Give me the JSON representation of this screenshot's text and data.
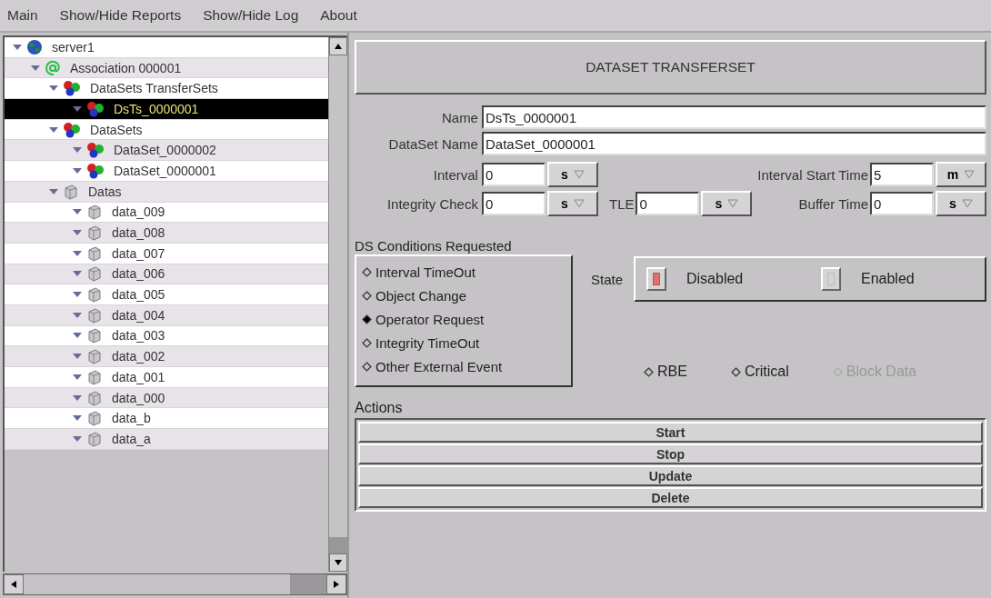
{
  "menu": [
    "Main",
    "Show/Hide Reports",
    "Show/Hide Log",
    "About"
  ],
  "tree": [
    {
      "label": "server1",
      "kind": "globe",
      "expanded": true,
      "selected": false,
      "children": [
        {
          "label": "Association 000001",
          "kind": "association",
          "expanded": true,
          "selected": false,
          "children": [
            {
              "label": "DataSets TransferSets",
              "kind": "dataset",
              "expanded": true,
              "selected": false,
              "children": [
                {
                  "label": "DsTs_0000001",
                  "kind": "dataset",
                  "expanded": true,
                  "selected": true
                }
              ]
            },
            {
              "label": "DataSets",
              "kind": "dataset",
              "expanded": true,
              "selected": false,
              "children": [
                {
                  "label": "DataSet_0000002",
                  "kind": "dataset",
                  "expanded": true,
                  "selected": false
                },
                {
                  "label": "DataSet_0000001",
                  "kind": "dataset",
                  "expanded": true,
                  "selected": false
                }
              ]
            },
            {
              "label": "Datas",
              "kind": "data",
              "expanded": true,
              "selected": false,
              "children": [
                {
                  "label": "data_009",
                  "kind": "data",
                  "expanded": true,
                  "selected": false
                },
                {
                  "label": "data_008",
                  "kind": "data",
                  "expanded": true,
                  "selected": false
                },
                {
                  "label": "data_007",
                  "kind": "data",
                  "expanded": true,
                  "selected": false
                },
                {
                  "label": "data_006",
                  "kind": "data",
                  "expanded": true,
                  "selected": false
                },
                {
                  "label": "data_005",
                  "kind": "data",
                  "expanded": true,
                  "selected": false
                },
                {
                  "label": "data_004",
                  "kind": "data",
                  "expanded": true,
                  "selected": false
                },
                {
                  "label": "data_003",
                  "kind": "data",
                  "expanded": true,
                  "selected": false
                },
                {
                  "label": "data_002",
                  "kind": "data",
                  "expanded": true,
                  "selected": false
                },
                {
                  "label": "data_001",
                  "kind": "data",
                  "expanded": true,
                  "selected": false
                },
                {
                  "label": "data_000",
                  "kind": "data",
                  "expanded": true,
                  "selected": false
                },
                {
                  "label": "data_b",
                  "kind": "data",
                  "expanded": true,
                  "selected": false
                },
                {
                  "label": "data_a",
                  "kind": "data",
                  "expanded": true,
                  "selected": false
                }
              ]
            }
          ]
        }
      ]
    }
  ],
  "header": "DATASET TRANSFERSET",
  "name": {
    "label": "Name",
    "value": "DsTs_0000001"
  },
  "dataset_name": {
    "label": "DataSet Name",
    "value": "DataSet_0000001"
  },
  "times": [
    [
      {
        "label": "Interval",
        "value": "0",
        "unit": "s"
      },
      {
        "label": "Interval Start Time",
        "value": "5",
        "unit": "m"
      }
    ],
    [
      {
        "label": "Integrity Check",
        "value": "0",
        "unit": "s"
      },
      {
        "label": "TLE",
        "value": "0",
        "unit": "s"
      },
      {
        "label": "Buffer Time",
        "value": "0",
        "unit": "s"
      }
    ]
  ],
  "conditions": {
    "title": "DS Conditions Requested",
    "items": [
      {
        "label": "Interval TimeOut",
        "checked": false
      },
      {
        "label": "Object Change",
        "checked": false
      },
      {
        "label": "Operator Request",
        "checked": true
      },
      {
        "label": "Integrity TimeOut",
        "checked": false
      },
      {
        "label": "Other External Event",
        "checked": false
      }
    ]
  },
  "state": {
    "label": "State",
    "options": [
      {
        "label": "Disabled",
        "selected": true
      },
      {
        "label": "Enabled",
        "selected": false
      }
    ]
  },
  "flags": [
    {
      "label": "RBE",
      "checked": false,
      "disabled": false
    },
    {
      "label": "Critical",
      "checked": false,
      "disabled": false
    },
    {
      "label": "Block Data",
      "checked": false,
      "disabled": true
    }
  ],
  "actions": {
    "title": "Actions",
    "buttons": [
      "Start",
      "Stop",
      "Update",
      "Delete"
    ]
  }
}
